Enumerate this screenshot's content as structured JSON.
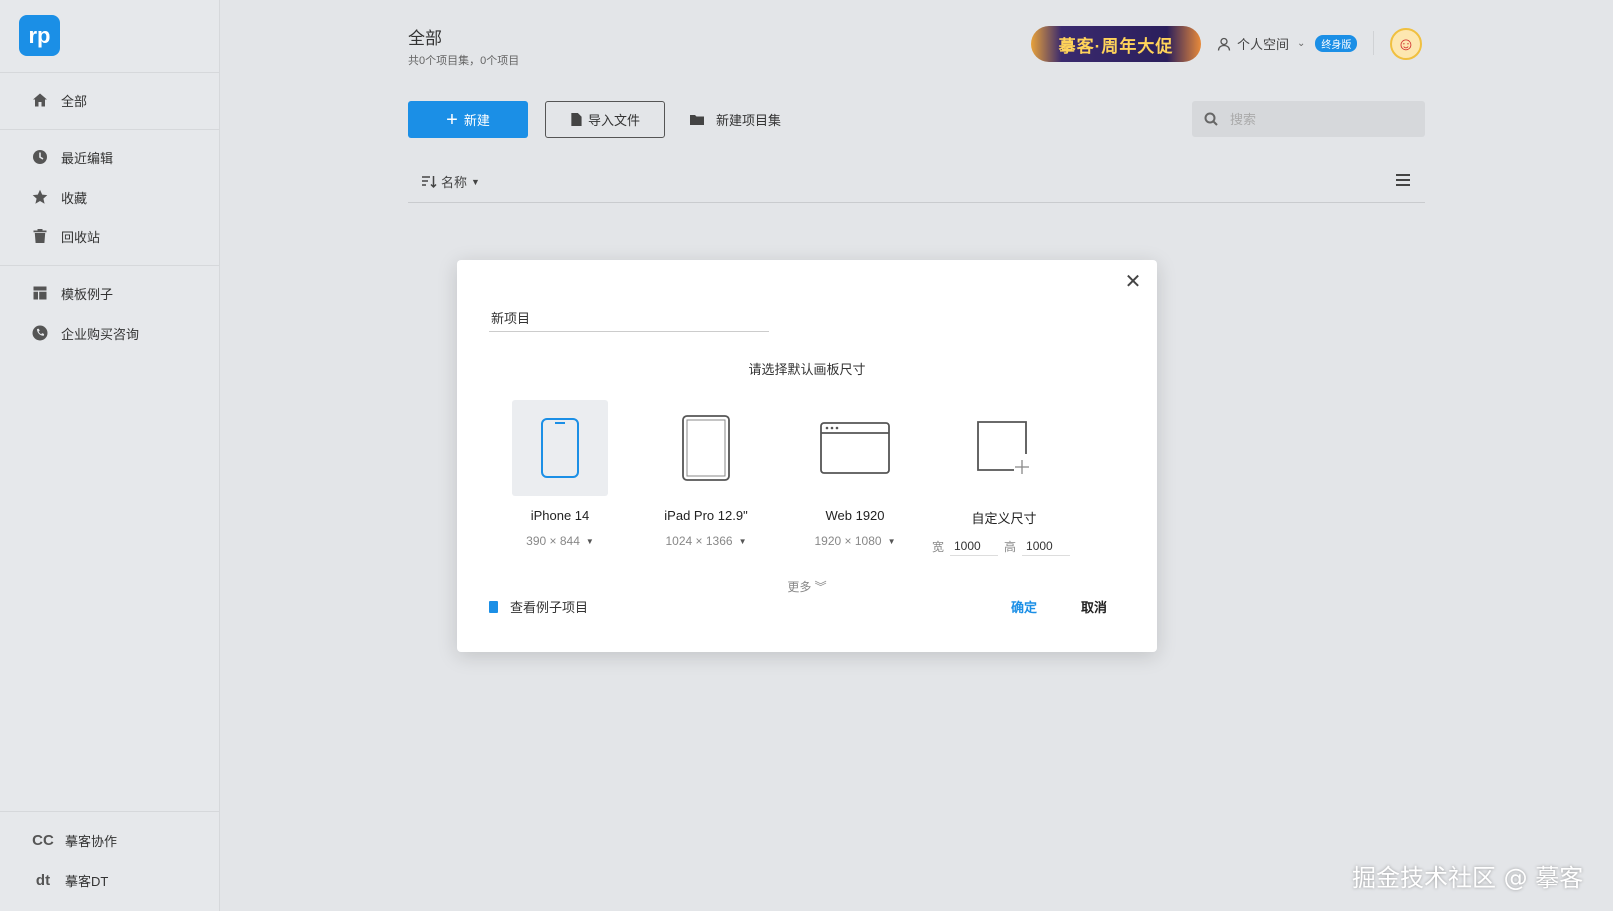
{
  "sidebar": {
    "logo_text": "rp",
    "items": [
      {
        "label": "全部",
        "icon": "home-icon"
      },
      {
        "label": "最近编辑",
        "icon": "clock-icon"
      },
      {
        "label": "收藏",
        "icon": "star-icon"
      },
      {
        "label": "回收站",
        "icon": "trash-icon"
      },
      {
        "label": "模板例子",
        "icon": "template-icon"
      },
      {
        "label": "企业购买咨询",
        "icon": "phone-icon"
      }
    ],
    "bottom": [
      {
        "label": "摹客协作",
        "icon_text": "CC"
      },
      {
        "label": "摹客DT",
        "icon_text": "dt"
      }
    ]
  },
  "header": {
    "title": "全部",
    "subtitle": "共0个项目集，0个项目",
    "promo": "摹客·周年大促",
    "space_label": "个人空间",
    "badge": "终身版"
  },
  "toolbar": {
    "new_label": "新建",
    "import_label": "导入文件",
    "new_folder_label": "新建项目集",
    "search_placeholder": "搜索",
    "sort_label": "名称"
  },
  "dialog": {
    "name_value": "新项目",
    "prompt": "请选择默认画板尺寸",
    "options": [
      {
        "name": "iPhone 14",
        "dims": "390 × 844"
      },
      {
        "name": "iPad Pro 12.9\"",
        "dims": "1024 × 1366"
      },
      {
        "name": "Web 1920",
        "dims": "1920 × 1080"
      },
      {
        "name": "自定义尺寸",
        "width_label": "宽",
        "width_value": "1000",
        "height_label": "高",
        "height_value": "1000"
      }
    ],
    "more": "更多",
    "example_link": "查看例子项目",
    "ok": "确定",
    "cancel": "取消"
  },
  "watermark": "掘金技术社区 @ 摹客",
  "colors": {
    "accent": "#1b8fe6",
    "background": "#e3e5e8"
  }
}
